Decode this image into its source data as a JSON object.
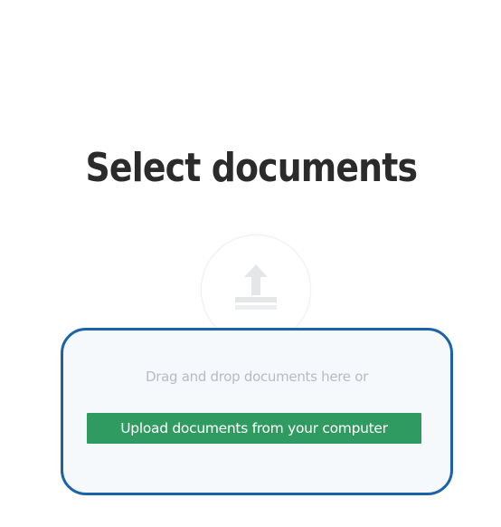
{
  "page": {
    "title": "Select documents"
  },
  "upload": {
    "icon": "upload-icon",
    "drop_text": "Drag and drop documents here or",
    "button_label": "Upload documents from your computer"
  },
  "colors": {
    "border_accent": "#1a63a8",
    "button_green": "#2f9b61",
    "drop_zone_bg": "#f5f9fc"
  }
}
